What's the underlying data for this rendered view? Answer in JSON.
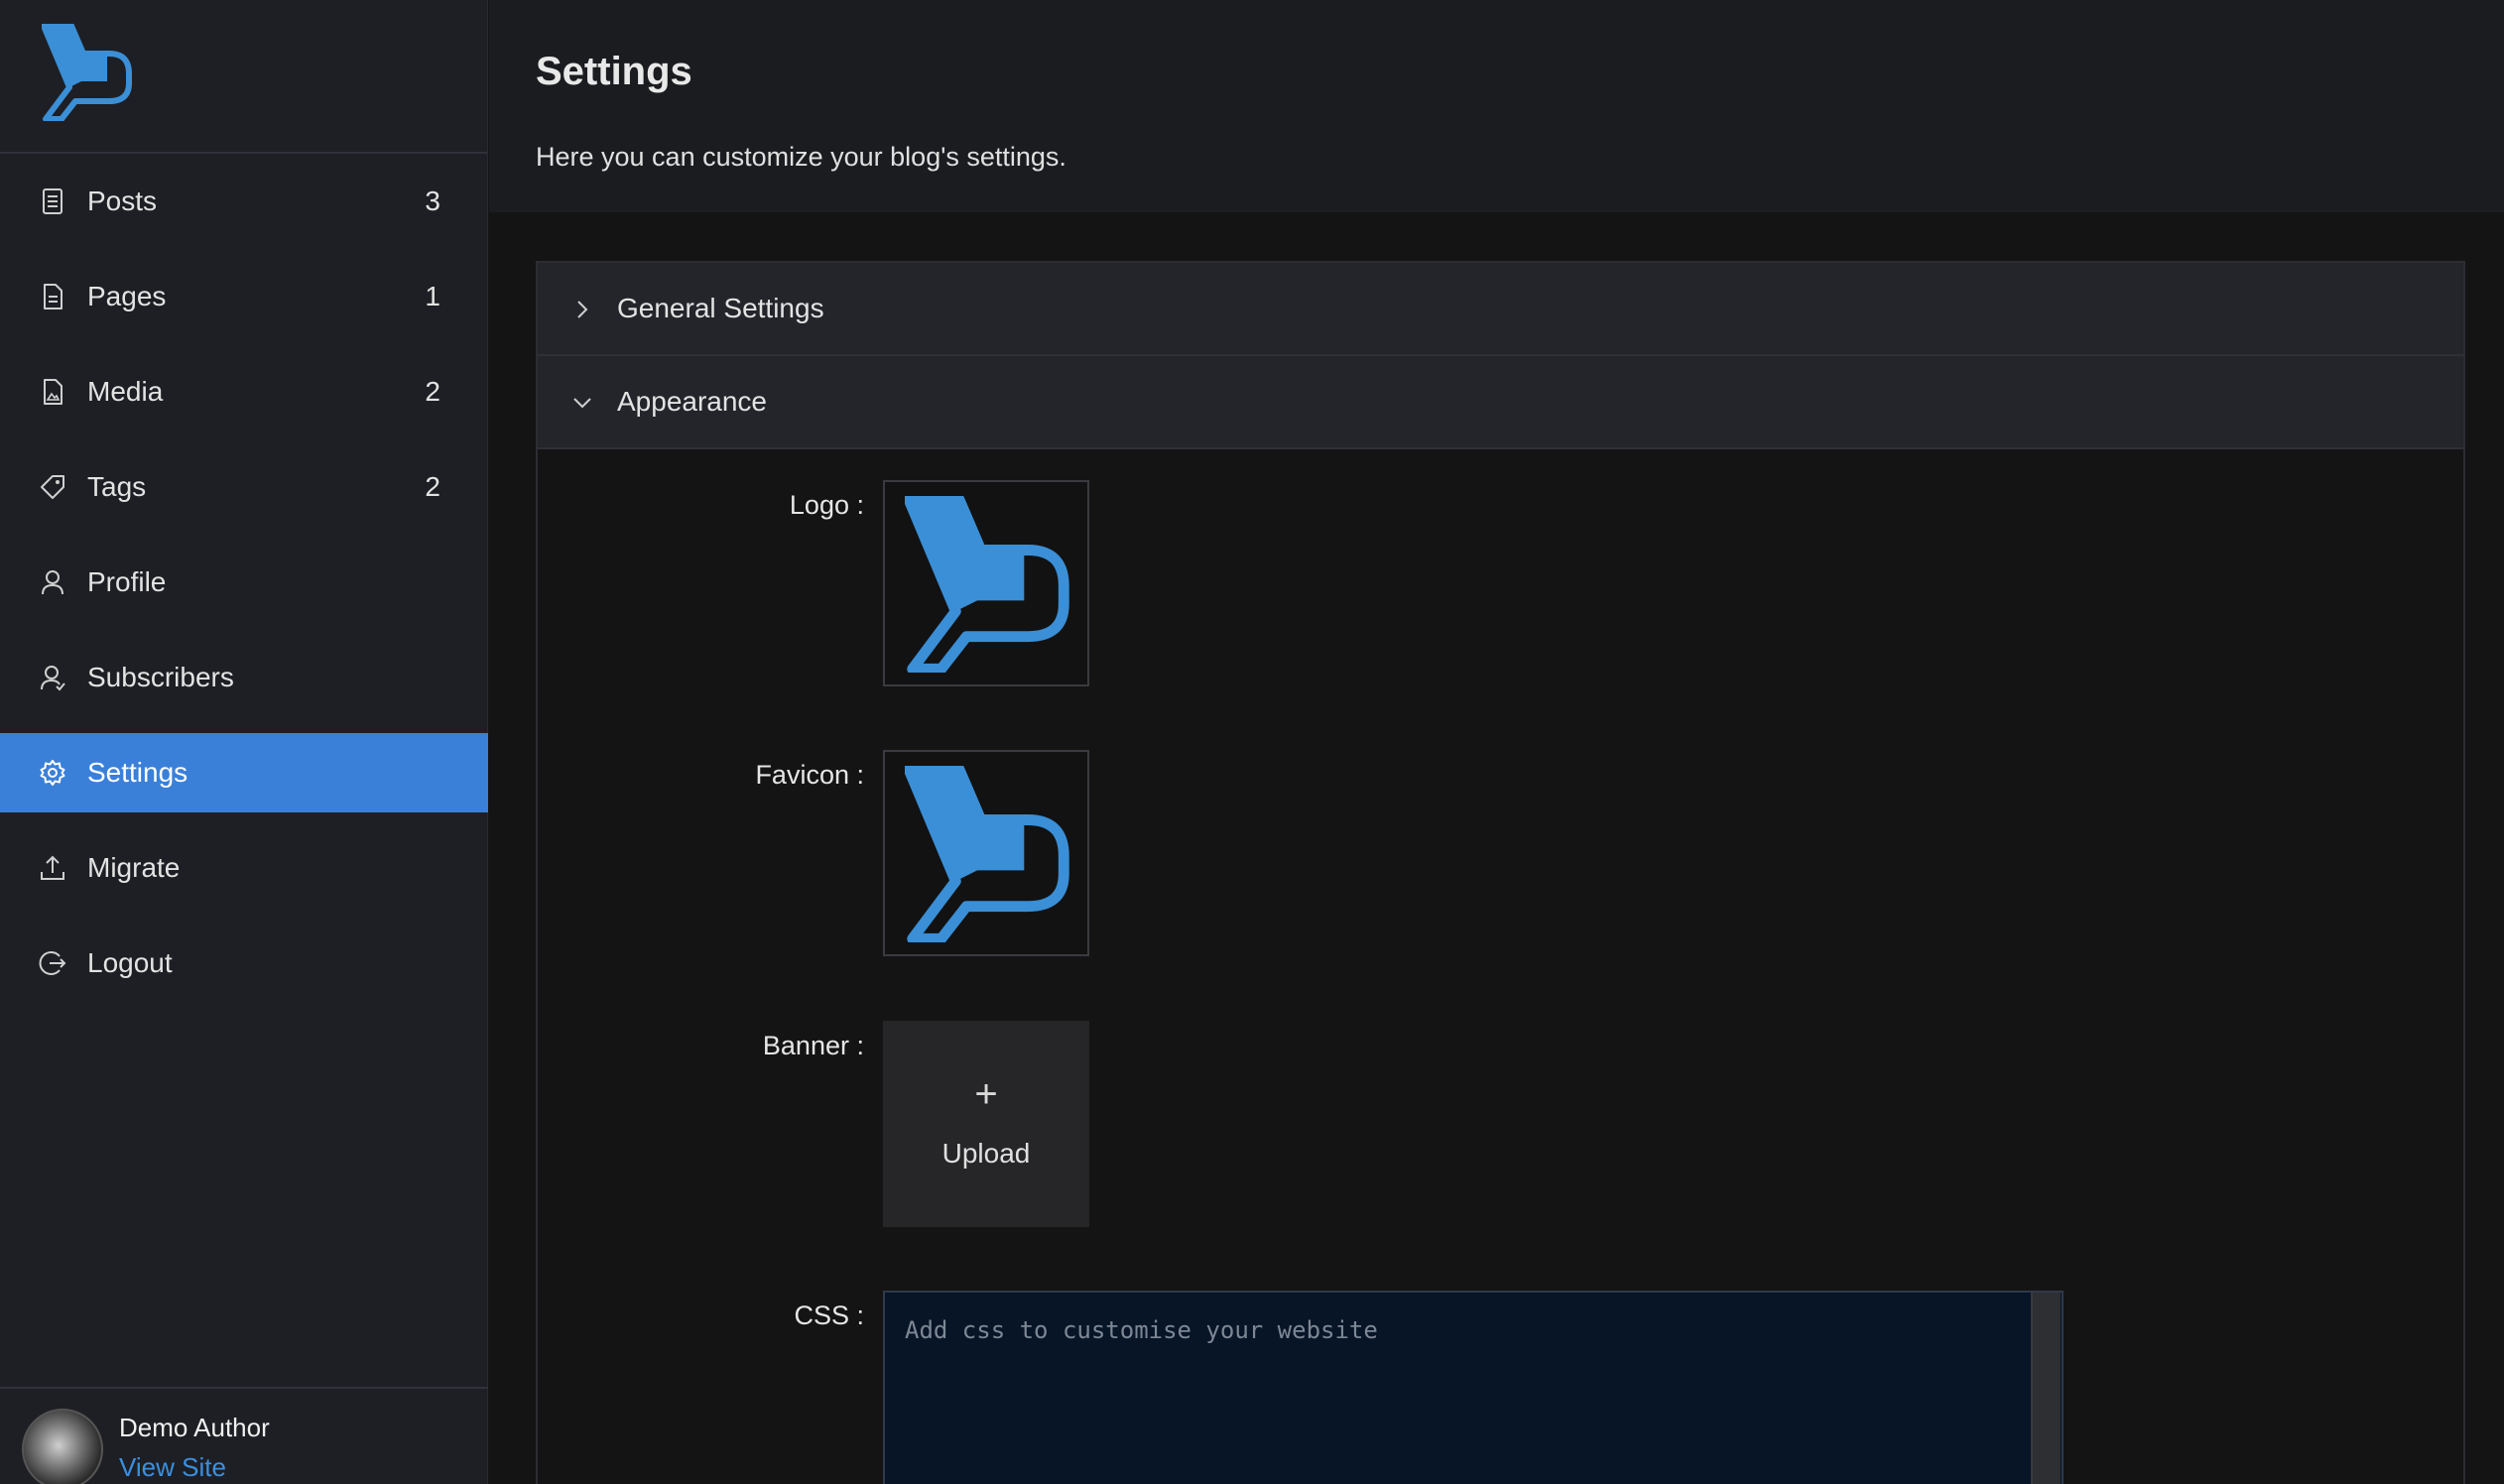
{
  "sidebar": {
    "items": [
      {
        "label": "Posts",
        "count": "3",
        "icon": "document-list-icon"
      },
      {
        "label": "Pages",
        "count": "1",
        "icon": "file-icon"
      },
      {
        "label": "Media",
        "count": "2",
        "icon": "image-file-icon"
      },
      {
        "label": "Tags",
        "count": "2",
        "icon": "tag-icon"
      },
      {
        "label": "Profile",
        "count": "",
        "icon": "user-icon"
      },
      {
        "label": "Subscribers",
        "count": "",
        "icon": "users-icon"
      },
      {
        "label": "Settings",
        "count": "",
        "icon": "gear-icon",
        "active": true
      },
      {
        "label": "Migrate",
        "count": "",
        "icon": "upload-icon"
      },
      {
        "label": "Logout",
        "count": "",
        "icon": "logout-icon"
      }
    ],
    "user": {
      "name": "Demo Author",
      "link": "View Site"
    }
  },
  "page": {
    "title": "Settings",
    "subtitle": "Here you can customize your blog's settings."
  },
  "sections": {
    "general": {
      "label": "General Settings",
      "expanded": false
    },
    "appearance": {
      "label": "Appearance",
      "expanded": true
    }
  },
  "appearance": {
    "logo_label": "Logo",
    "favicon_label": "Favicon",
    "banner_label": "Banner",
    "upload_plus": "+",
    "upload_label": "Upload",
    "css_label": "CSS",
    "css_placeholder": "Add css to customise your website"
  },
  "colors": {
    "accent": "#3a80d8",
    "logo_blue": "#3a8fd6",
    "link": "#3b8fe0"
  }
}
